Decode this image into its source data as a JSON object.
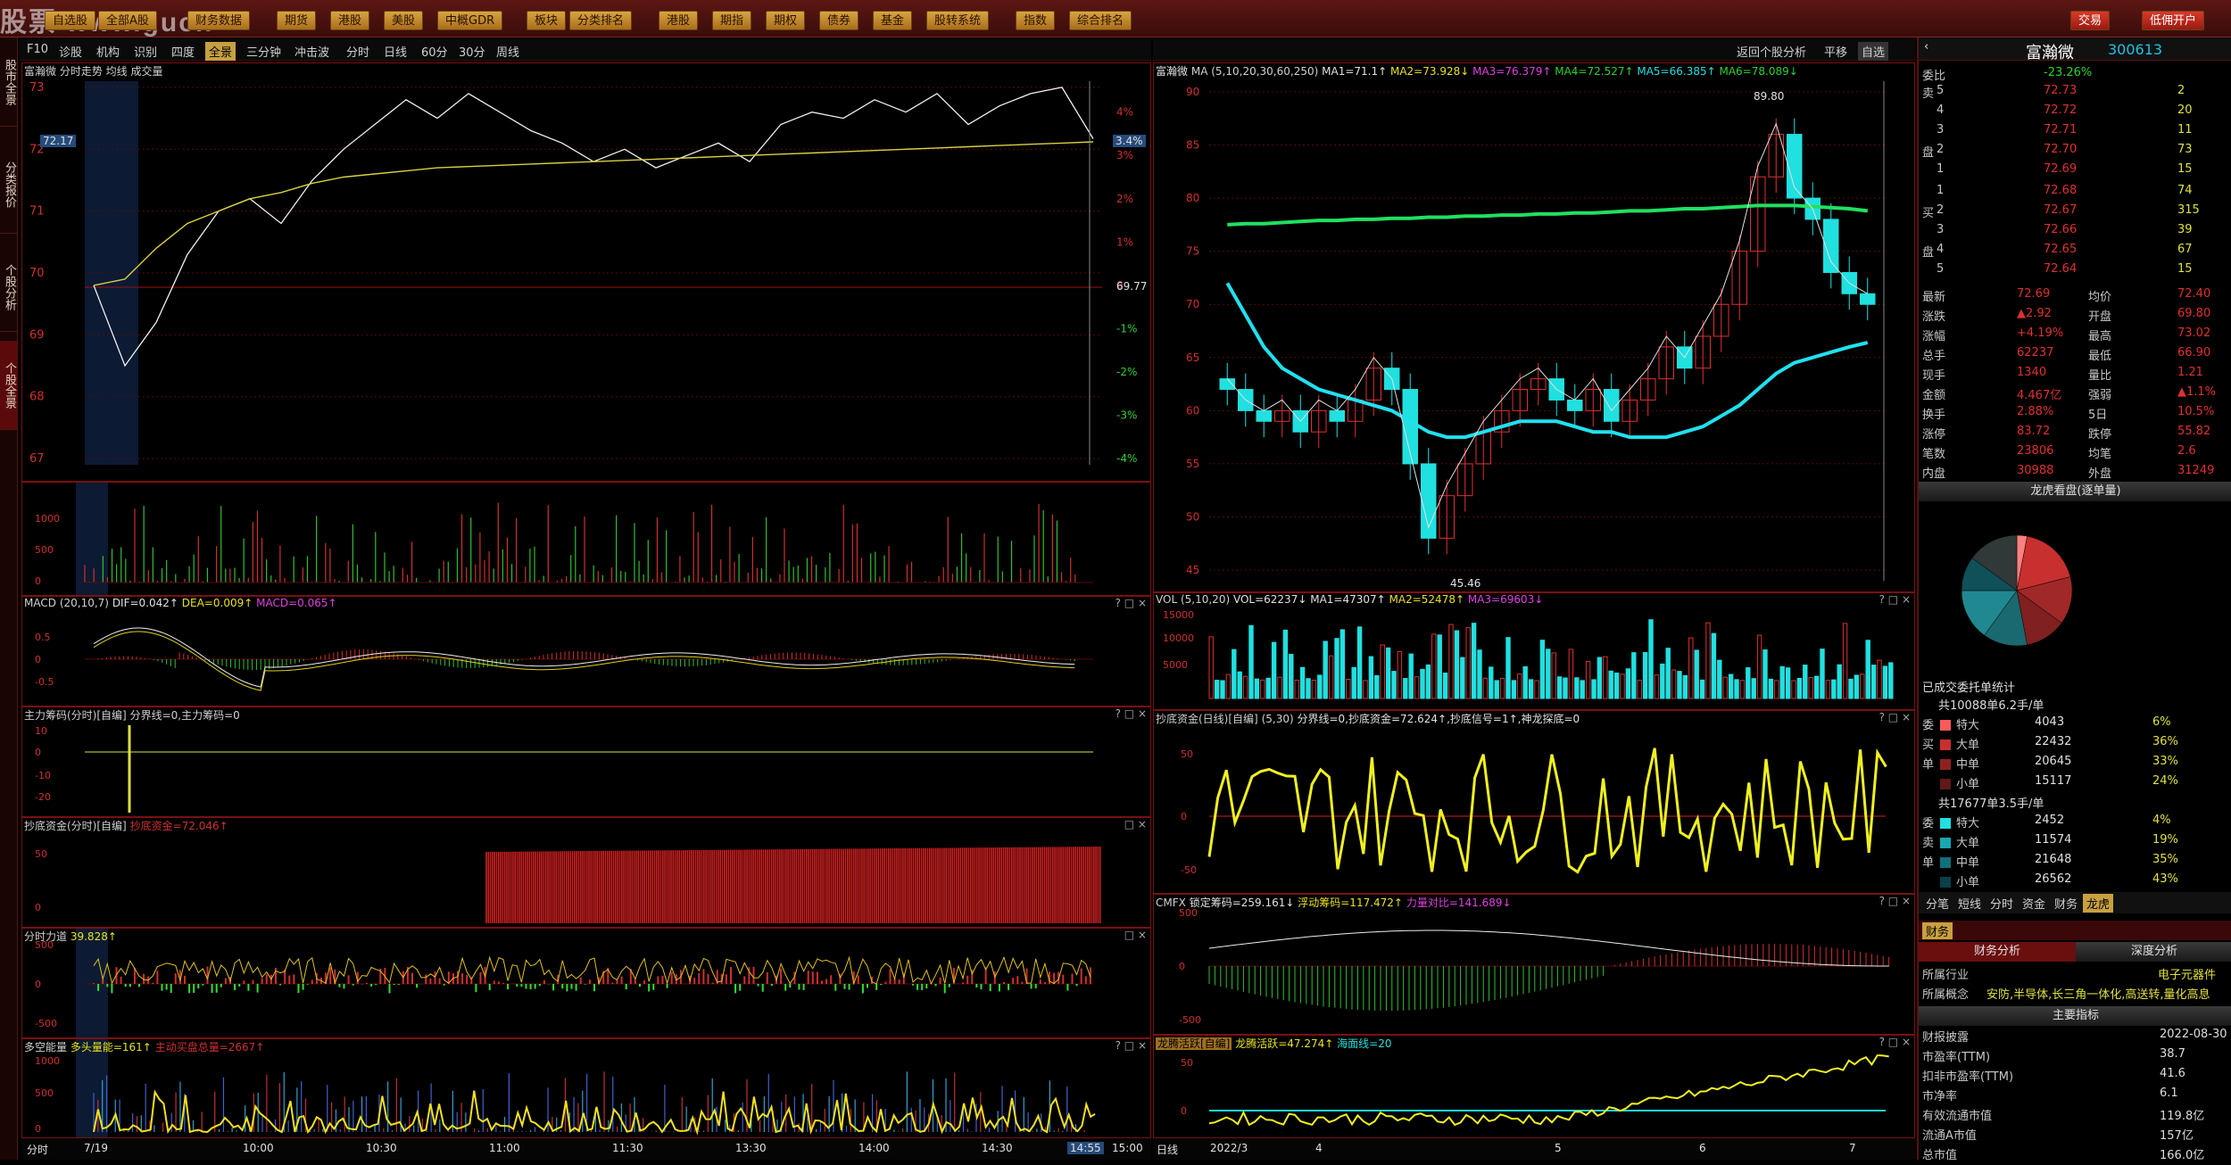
{
  "toolbar": {
    "logo": "股票 www.gucn",
    "buttons": [
      "自选股",
      "全部A股",
      "财务数据",
      "期货",
      "港股",
      "美股",
      "中概GDR",
      "板块",
      "分类排名",
      "港股",
      "期指",
      "期权",
      "债券",
      "基金",
      "股转系统",
      "指数",
      "综合排名"
    ],
    "trade": "交易",
    "open_account": "低佣开户",
    "window_title": "富瀚微 - 分时走势"
  },
  "sidebar": [
    "股市全景",
    "分类报价",
    "个股分析",
    "个股全景"
  ],
  "intraday_nav": {
    "items": [
      "F10",
      "诊股",
      "机构",
      "识别",
      "四度",
      "全景",
      "三分钟",
      "冲击波",
      "分时",
      "日线",
      "60分",
      "30分",
      "周线"
    ],
    "active": "全景"
  },
  "daily_nav": {
    "items": [
      "返回个股分析",
      "平移",
      "自选"
    ]
  },
  "intraday": {
    "title": "富瀚微 分时走势 均线 成交量",
    "price_ticks": [
      "73",
      "72",
      "71",
      "70",
      "69",
      "68",
      "67"
    ],
    "current_price_tag": "72.17",
    "pct_ticks": [
      "4%",
      "3%",
      "2%",
      "1%",
      "0",
      "-1%",
      "-2%",
      "-3%",
      "-4%"
    ],
    "pct_tag": "3.4%",
    "base_price": "69.77",
    "vol_ticks": [
      "1000",
      "500",
      "0"
    ],
    "time_ticks": [
      "7/19",
      "10:00",
      "10:30",
      "11:00",
      "11:30",
      "13:30",
      "14:00",
      "14:30",
      "14:55",
      "15:00"
    ],
    "bottom_label": "分时",
    "macd": {
      "title": "MACD",
      "params": "(20,10,7)",
      "dif": "DIF=0.042↑",
      "dea": "DEA=0.009↑",
      "macd": "MACD=0.065↑",
      "ticks": [
        "0.5",
        "0",
        "-0.5"
      ]
    },
    "chip": {
      "title": "主力筹码(分时)[自编]",
      "sub": "分界线=0,主力筹码=0",
      "ticks": [
        "10",
        "0",
        "-10",
        "-20"
      ]
    },
    "bottom_fund": {
      "title": "抄底资金(分时)[自编]",
      "val": "抄底资金=72.046↑",
      "ticks": [
        "50",
        "0"
      ]
    },
    "force": {
      "title": "分时力道",
      "val": "39.828↑",
      "ticks": [
        "500",
        "0",
        "-500"
      ]
    },
    "multi": {
      "title": "多空能量",
      "bull": "多头量能=161↑",
      "main": "主动买盘总量=2667↑",
      "ticks": [
        "1000",
        "500",
        "0"
      ]
    }
  },
  "daily": {
    "title": "富瀚微",
    "ma_label": "MA",
    "ma_params": "(5,10,20,30,60,250)",
    "ma_values": [
      "MA1=71.1↑",
      "MA2=73.928↓",
      "MA3=76.379↑",
      "MA4=72.527↑",
      "MA5=66.385↑",
      "MA6=78.089↓"
    ],
    "ticks": [
      "90",
      "85",
      "80",
      "75",
      "70",
      "65",
      "60",
      "55",
      "50",
      "45"
    ],
    "high_label": "89.80",
    "low_label": "45.46",
    "date_ticks": [
      "2022/3",
      "4",
      "5",
      "6",
      "7"
    ],
    "bottom_label": "日线",
    "vol": {
      "title": "VOL",
      "params": "(5,10,20)",
      "v1": "VOL=62237↓",
      "v2": "MA1=47307↑",
      "v3": "MA2=52478↑",
      "v4": "MA3=69603↓",
      "ticks": [
        "15000",
        "10000",
        "5000"
      ]
    },
    "bottom_fund": {
      "title": "抄底资金(日线)[自编]",
      "params": "(5,30)",
      "v1": "分界线=0,抄底资金=72.624↑,抄底信号=1↑,神龙探底=0",
      "ticks": [
        "50",
        "0",
        "-50"
      ]
    },
    "cmfx": {
      "title": "CMFX",
      "v1": "锁定筹码=259.161↓",
      "v2": "浮动筹码=117.472↑",
      "v3": "力量对比=141.689↓",
      "ticks": [
        "500",
        "0",
        "-500"
      ]
    },
    "dragon": {
      "title": "龙腾活跃[自编]",
      "v1": "龙腾活跃=47.274↑",
      "v2": "海面线=20",
      "ticks": [
        "50",
        "0"
      ]
    }
  },
  "chart_data": [
    {
      "type": "line",
      "title": "分时走势",
      "ylim": [
        66.9,
        73.1
      ],
      "series": [
        {
          "name": "price",
          "values": [
            69.8,
            68.5,
            69.2,
            70.3,
            71.0,
            71.2,
            70.8,
            71.5,
            72.0,
            72.4,
            72.8,
            72.5,
            72.9,
            72.6,
            72.3,
            72.1,
            71.8,
            72.0,
            71.7,
            71.9,
            72.1,
            71.8,
            72.4,
            72.6,
            72.5,
            72.8,
            72.6,
            72.9,
            72.4,
            72.7,
            72.9,
            73.0,
            72.17
          ]
        },
        {
          "name": "均线",
          "values": [
            69.8,
            69.9,
            70.4,
            70.8,
            71.0,
            71.2,
            71.3,
            71.45,
            71.55,
            71.6,
            71.65,
            71.7,
            71.72,
            71.74,
            71.76,
            71.78,
            71.8,
            71.82,
            71.84,
            71.86,
            71.88,
            71.9,
            71.92,
            71.94,
            71.96,
            71.98,
            72.0,
            72.02,
            72.04,
            72.06,
            72.08,
            72.1,
            72.12
          ]
        }
      ]
    },
    {
      "type": "line",
      "title": "日线",
      "ylim": [
        44,
        91
      ],
      "series": [
        {
          "name": "close",
          "values": [
            62,
            60,
            59,
            60,
            58,
            60,
            59,
            61,
            64,
            62,
            55,
            48,
            52,
            55,
            58,
            60,
            62,
            63,
            61,
            60,
            62,
            59,
            61,
            63,
            66,
            64,
            67,
            70,
            75,
            82,
            86,
            80,
            78,
            73,
            71,
            70
          ]
        },
        {
          "name": "MA250",
          "values": [
            77.5,
            77.6,
            77.6,
            77.7,
            77.8,
            77.9,
            77.9,
            78.0,
            78.0,
            78.1,
            78.1,
            78.2,
            78.2,
            78.3,
            78.3,
            78.4,
            78.4,
            78.5,
            78.5,
            78.6,
            78.6,
            78.7,
            78.8,
            78.8,
            78.9,
            79.0,
            79.0,
            79.1,
            79.2,
            79.3,
            79.3,
            79.3,
            79.2,
            79.1,
            79.0,
            78.8
          ]
        },
        {
          "name": "MA60",
          "values": [
            72,
            69,
            66,
            64,
            63,
            62,
            61.5,
            61,
            60.5,
            60,
            59,
            58,
            57.5,
            57.5,
            58,
            58.5,
            59,
            59,
            59,
            58.5,
            58,
            58,
            57.5,
            57.5,
            57.5,
            58,
            58.5,
            59.5,
            60.5,
            62,
            63.5,
            64.5,
            65,
            65.5,
            66,
            66.4
          ]
        }
      ]
    }
  ],
  "right": {
    "name": "富瀚微",
    "code": "300613",
    "webi": [
      "委比",
      "-23.26%"
    ],
    "asks": [
      [
        "卖",
        "5",
        "72.73",
        "2"
      ],
      [
        "",
        "4",
        "72.72",
        "20"
      ],
      [
        "",
        "3",
        "72.71",
        "11"
      ],
      [
        "盘",
        "2",
        "72.70",
        "73"
      ],
      [
        "",
        "1",
        "72.69",
        "15"
      ]
    ],
    "bids": [
      [
        "",
        "1",
        "72.68",
        "74"
      ],
      [
        "买",
        "2",
        "72.67",
        "315"
      ],
      [
        "",
        "3",
        "72.66",
        "39"
      ],
      [
        "盘",
        "4",
        "72.65",
        "67"
      ],
      [
        "",
        "5",
        "72.64",
        "15"
      ]
    ],
    "stats": [
      [
        "最新",
        "72.69",
        "均价",
        "72.40"
      ],
      [
        "涨跌",
        "▲2.92",
        "开盘",
        "69.80"
      ],
      [
        "涨幅",
        "+4.19%",
        "最高",
        "73.02"
      ],
      [
        "总手",
        "62237",
        "最低",
        "66.90"
      ],
      [
        "现手",
        "1340",
        "量比",
        "1.21"
      ],
      [
        "金额",
        "4.467亿",
        "强弱",
        "▲1.1%"
      ],
      [
        "换手",
        "2.88%",
        "5日",
        "10.5%"
      ],
      [
        "涨停",
        "83.72",
        "跌停",
        "55.82"
      ],
      [
        "笔数",
        "23806",
        "均笔",
        "2.6"
      ],
      [
        "内盘",
        "30988",
        "外盘",
        "31249"
      ]
    ],
    "pie_title": "龙虎看盘(逐单量)",
    "pie_values": [
      3,
      18,
      14,
      12,
      13,
      15,
      10,
      15
    ],
    "pie_colors": [
      "#ff8080",
      "#c83030",
      "#a02828",
      "#802020",
      "#1a6870",
      "#208890",
      "#105058",
      "#303838"
    ],
    "entrust_title": "已成交委托单统计",
    "buy_total": "共10088单6.2手/单",
    "buy": [
      [
        "委",
        "特大",
        "4043",
        "6%"
      ],
      [
        "买",
        "大单",
        "22432",
        "36%"
      ],
      [
        "单",
        "中单",
        "20645",
        "33%"
      ],
      [
        "",
        "小单",
        "15117",
        "24%"
      ]
    ],
    "sell_total": "共17677单3.5手/单",
    "sell": [
      [
        "委",
        "特大",
        "2452",
        "4%"
      ],
      [
        "卖",
        "大单",
        "11574",
        "19%"
      ],
      [
        "单",
        "中单",
        "21648",
        "35%"
      ],
      [
        "",
        "小单",
        "26562",
        "43%"
      ]
    ],
    "tabs": [
      "分笔",
      "短线",
      "分时",
      "资金",
      "财务",
      "龙虎"
    ],
    "fin_tab": "财务",
    "fin_subtabs": [
      "财务分析",
      "深度分析"
    ],
    "industry": [
      "所属行业",
      "电子元器件"
    ],
    "concept": [
      "所属概念",
      "安防,半导体,长三角一体化,高送转,量化高息"
    ],
    "main_index": "主要指标",
    "fin_rows": [
      [
        "财报披露",
        "2022-08-30"
      ],
      [
        "市盈率(TTM)",
        "38.7"
      ],
      [
        "扣非市盈率(TTM)",
        "41.6"
      ],
      [
        "市净率",
        "6.1"
      ],
      [
        "有效流通市值",
        "119.8亿"
      ],
      [
        "流通A市值",
        "157亿"
      ],
      [
        "总市值",
        "166.0亿"
      ]
    ]
  }
}
